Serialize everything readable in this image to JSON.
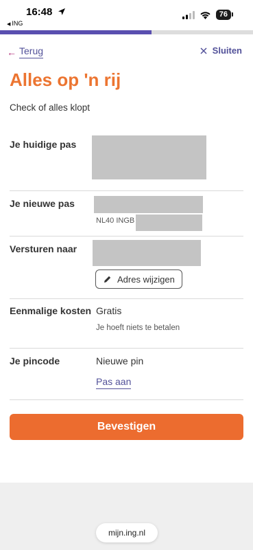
{
  "status_bar": {
    "time": "16:48",
    "back_app": "ING",
    "battery": "76"
  },
  "progress": {
    "fraction": 0.6
  },
  "nav": {
    "back_label": "Terug",
    "close_label": "Sluiten"
  },
  "page": {
    "title": "Alles op 'n rij",
    "subtitle": "Check of alles klopt"
  },
  "rows": {
    "current_card": {
      "label": "Je huidige pas"
    },
    "new_card": {
      "label": "Je nieuwe pas",
      "iban_prefix": "NL40 INGB"
    },
    "ship_to": {
      "label": "Versturen naar",
      "change_address_label": "Adres wijzigen"
    },
    "one_time_cost": {
      "label": "Eenmalige kosten",
      "value": "Gratis",
      "note": "Je hoeft niets te betalen"
    },
    "pin": {
      "label": "Je pincode",
      "value": "Nieuwe pin",
      "adjust_label": "Pas aan"
    }
  },
  "confirm_label": "Bevestigen",
  "browser": {
    "url": "mijn.ing.nl"
  },
  "colors": {
    "brand_orange": "#ec7531",
    "button_orange": "#ec6c2f",
    "link_purple": "#525199",
    "progress_purple": "#5a4fb0"
  }
}
